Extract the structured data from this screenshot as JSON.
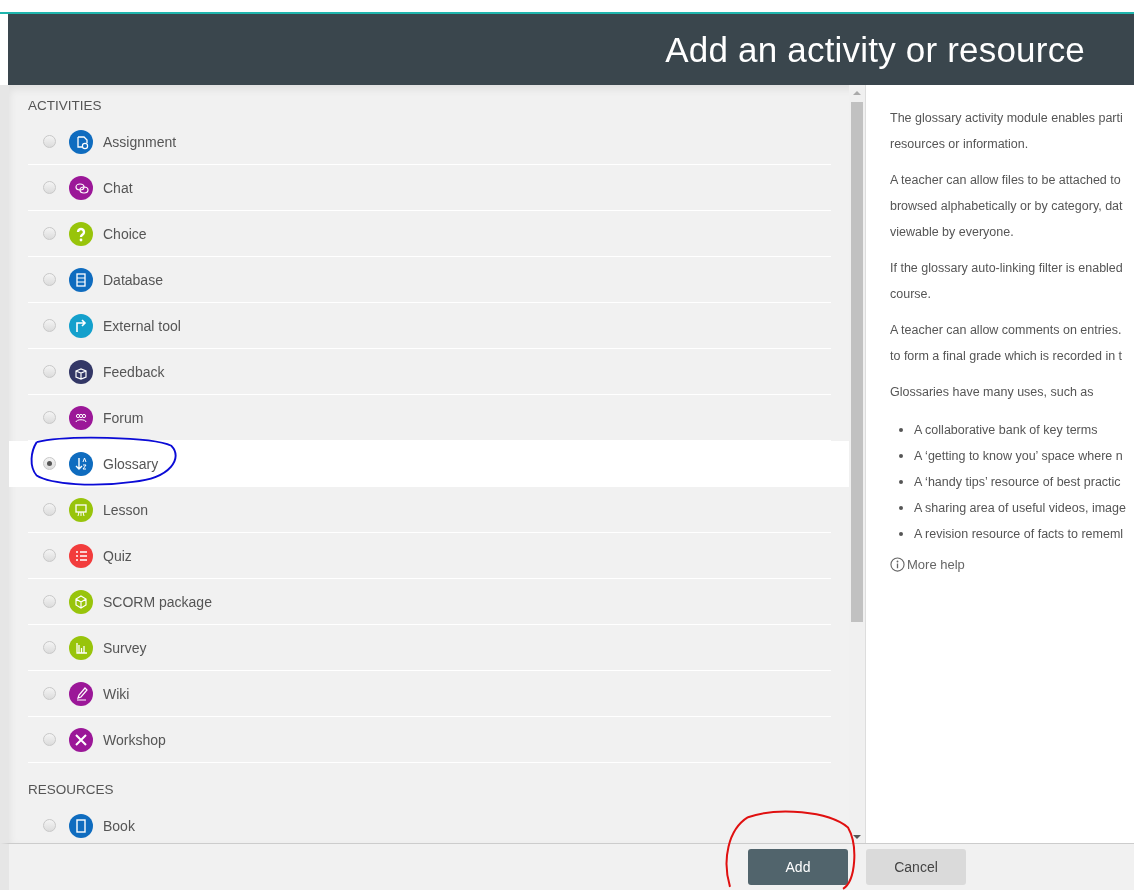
{
  "dialog": {
    "title": "Add an activity or resource"
  },
  "sections": [
    {
      "heading": "ACTIVITIES",
      "items": [
        {
          "label": "Assignment",
          "color": "#0f6cbf",
          "selected": false,
          "circled": false
        },
        {
          "label": "Chat",
          "color": "#9b1798",
          "selected": false,
          "circled": false
        },
        {
          "label": "Choice",
          "color": "#98c40b",
          "selected": false,
          "circled": false
        },
        {
          "label": "Database",
          "color": "#0f6cbf",
          "selected": false,
          "circled": false
        },
        {
          "label": "External tool",
          "color": "#14a0cc",
          "selected": false,
          "circled": false
        },
        {
          "label": "Feedback",
          "color": "#333766",
          "selected": false,
          "circled": false
        },
        {
          "label": "Forum",
          "color": "#9b1798",
          "selected": false,
          "circled": false
        },
        {
          "label": "Glossary",
          "color": "#0f6cbf",
          "selected": true,
          "circled": true
        },
        {
          "label": "Lesson",
          "color": "#98c40b",
          "selected": false,
          "circled": false
        },
        {
          "label": "Quiz",
          "color": "#f23c3c",
          "selected": false,
          "circled": false
        },
        {
          "label": "SCORM package",
          "color": "#98c40b",
          "selected": false,
          "circled": false
        },
        {
          "label": "Survey",
          "color": "#98c40b",
          "selected": false,
          "circled": false
        },
        {
          "label": "Wiki",
          "color": "#9b1798",
          "selected": false,
          "circled": false
        },
        {
          "label": "Workshop",
          "color": "#9b1798",
          "selected": false,
          "circled": false
        }
      ]
    },
    {
      "heading": "RESOURCES",
      "items": [
        {
          "label": "Book",
          "color": "#0f6cbf",
          "selected": false,
          "circled": false
        }
      ]
    }
  ],
  "help": {
    "paragraphs": [
      [
        "The glossary activity module enables parti",
        "resources or information."
      ],
      [
        "A teacher can allow files to be attached to",
        "browsed alphabetically or by category, dat",
        "viewable by everyone."
      ],
      [
        "If the glossary auto-linking filter is enabled",
        "course."
      ],
      [
        "A teacher can allow comments on entries.",
        "to form a final grade which is recorded in t"
      ],
      [
        "Glossaries have many uses, such as"
      ]
    ],
    "bullets": [
      "A collaborative bank of key terms",
      "A ‘getting to know you’ space where n",
      "A ‘handy tips’ resource of best practic",
      "A sharing area of useful videos, image",
      "A revision resource of facts to rememl"
    ],
    "more_help": "More help"
  },
  "buttons": [
    {
      "label": "Add",
      "kind": "primary",
      "circled": true
    },
    {
      "label": "Cancel",
      "kind": "secondary",
      "circled": false
    }
  ]
}
